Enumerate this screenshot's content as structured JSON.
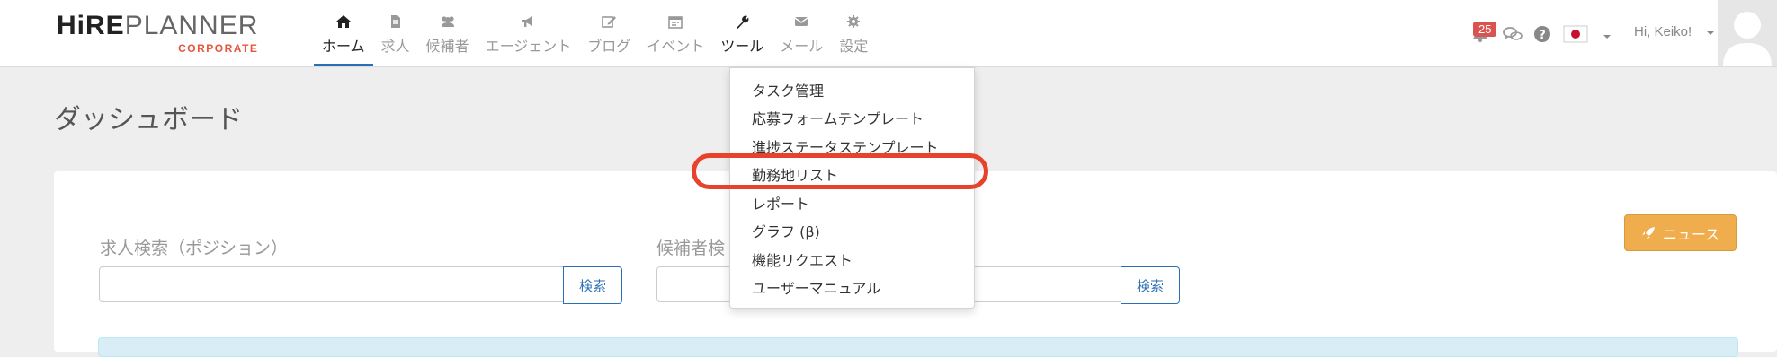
{
  "logo": {
    "hire": "HiRE",
    "planner": "PLANNER",
    "sub": "CORPORATE"
  },
  "nav": [
    {
      "label": "ホーム",
      "icon": "home-icon"
    },
    {
      "label": "求人",
      "icon": "document-icon"
    },
    {
      "label": "候補者",
      "icon": "users-icon"
    },
    {
      "label": "エージェント",
      "icon": "megaphone-icon"
    },
    {
      "label": "ブログ",
      "icon": "edit-icon"
    },
    {
      "label": "イベント",
      "icon": "calendar-icon"
    },
    {
      "label": "ツール",
      "icon": "wrench-icon"
    },
    {
      "label": "メール",
      "icon": "envelope-icon"
    },
    {
      "label": "設定",
      "icon": "gear-icon"
    }
  ],
  "header": {
    "notification_count": "25",
    "greeting": "Hi, Keiko!"
  },
  "page": {
    "title": "ダッシュボード"
  },
  "search": {
    "position_label": "求人検索（ポジション）",
    "position_button": "検索",
    "candidate_label": "候補者検",
    "candidate_button": "検索"
  },
  "news_button": "ニュース",
  "tools_menu": [
    "タスク管理",
    "応募フォームテンプレート",
    "進捗ステータステンプレート",
    "勤務地リスト",
    "レポート",
    "グラフ (β)",
    "機能リクエスト",
    "ユーザーマニュアル"
  ],
  "colors": {
    "accent": "#2a6fb5",
    "news": "#f0ad4e",
    "badge": "#d9534f",
    "highlight": "#e8412c",
    "logo_sub": "#e8553d"
  }
}
